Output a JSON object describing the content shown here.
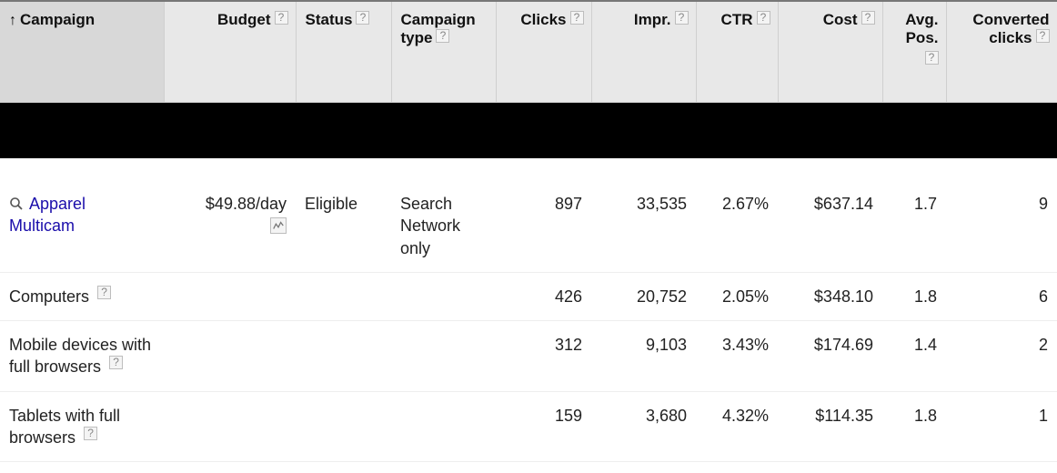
{
  "headers": {
    "campaign": "Campaign",
    "budget": "Budget",
    "status": "Status",
    "type": "Campaign type",
    "clicks": "Clicks",
    "impr": "Impr.",
    "ctr": "CTR",
    "cost": "Cost",
    "pos": "Avg. Pos.",
    "converted": "Converted clicks"
  },
  "help_glyph": "?",
  "sort_glyph": "↑",
  "rows": [
    {
      "name_link": "Apparel Multicam",
      "name_plain": "",
      "has_icon": true,
      "budget": "$49.88/day",
      "has_edit": true,
      "status": "Eligible",
      "type": "Search Network only",
      "clicks": "897",
      "impr": "33,535",
      "ctr": "2.67%",
      "cost": "$637.14",
      "pos": "1.7",
      "converted": "9"
    },
    {
      "name_link": "",
      "name_plain": "Computers",
      "has_icon": false,
      "has_help": true,
      "budget": "",
      "has_edit": false,
      "status": "",
      "type": "",
      "clicks": "426",
      "impr": "20,752",
      "ctr": "2.05%",
      "cost": "$348.10",
      "pos": "1.8",
      "converted": "6"
    },
    {
      "name_link": "",
      "name_plain": "Mobile devices with full browsers",
      "has_icon": false,
      "has_help": true,
      "budget": "",
      "has_edit": false,
      "status": "",
      "type": "",
      "clicks": "312",
      "impr": "9,103",
      "ctr": "3.43%",
      "cost": "$174.69",
      "pos": "1.4",
      "converted": "2"
    },
    {
      "name_link": "",
      "name_plain": "Tablets with full browsers",
      "has_icon": false,
      "has_help": true,
      "budget": "",
      "has_edit": false,
      "status": "",
      "type": "",
      "clicks": "159",
      "impr": "3,680",
      "ctr": "4.32%",
      "cost": "$114.35",
      "pos": "1.8",
      "converted": "1"
    }
  ]
}
